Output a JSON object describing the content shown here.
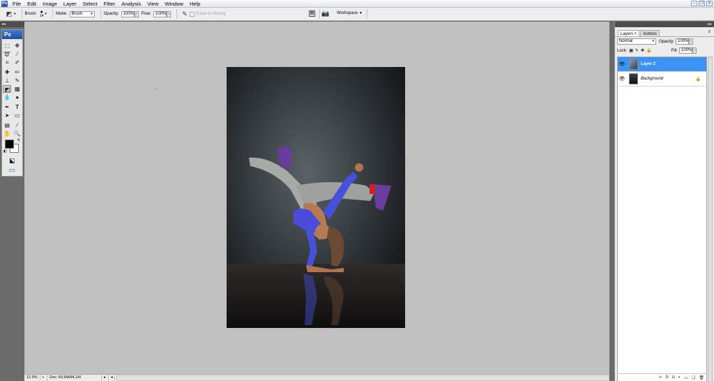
{
  "menu": {
    "items": [
      "File",
      "Edit",
      "Image",
      "Layer",
      "Select",
      "Filter",
      "Analysis",
      "View",
      "Window",
      "Help"
    ],
    "app_icon": "Ps"
  },
  "options": {
    "brush_label": "Brush:",
    "brush_size": "14",
    "mode_label": "Mode:",
    "mode_value": "Brush",
    "opacity_label": "Opacity:",
    "opacity_value": "100%",
    "flow_label": "Flow:",
    "flow_value": "100%",
    "erase_history_label": "Erase to History",
    "workspace_label": "Workspace"
  },
  "toolbox": {
    "collapse": "◂◂",
    "logo": "Ps"
  },
  "status": {
    "zoom": "12.5%",
    "doc_info": "Doc: 60,9M/84,1M"
  },
  "layers_panel": {
    "tabs": [
      "Layers ×",
      "Actions"
    ],
    "blend_mode": "Normal",
    "opacity_label": "Opacity:",
    "opacity_value": "100%",
    "lock_label": "Lock:",
    "fill_label": "Fill:",
    "fill_value": "100%",
    "layers": [
      {
        "name": "Layer 2",
        "selected": true,
        "visible": true
      },
      {
        "name": "Background",
        "selected": false,
        "visible": true,
        "locked": true
      }
    ]
  },
  "colors": {
    "selection_blue": "#3d93f4",
    "foreground": "#000000",
    "background": "#ffffff",
    "workspace_gray": "#c0c0c0"
  }
}
